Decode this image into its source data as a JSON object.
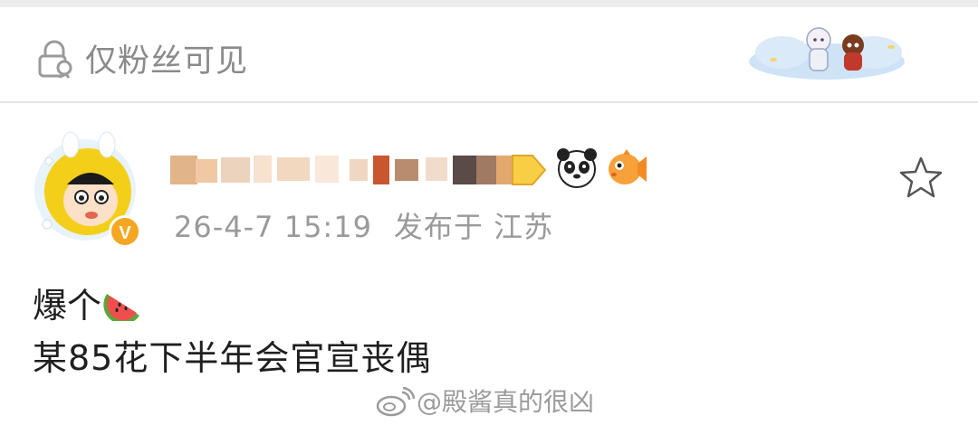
{
  "visibility": {
    "label": "仅粉丝可见",
    "icon": "lock-person-icon"
  },
  "post": {
    "timestamp": "26-4-7 15:19",
    "location": "发布于 江苏",
    "line1": "爆个",
    "line2": "某85花下半年会官宣丧偶",
    "emoji": "watermelon-icon"
  },
  "author": {
    "name_obscured": true,
    "badges": [
      "panda-badge-icon",
      "fish-badge-icon"
    ]
  },
  "watermark": {
    "text": "@殿酱真的很凶",
    "icon": "weibo-logo-icon"
  },
  "colors": {
    "muted_text": "#8a8a8a",
    "divider": "#e6e6e6",
    "verified_badge": "#f5a623"
  }
}
